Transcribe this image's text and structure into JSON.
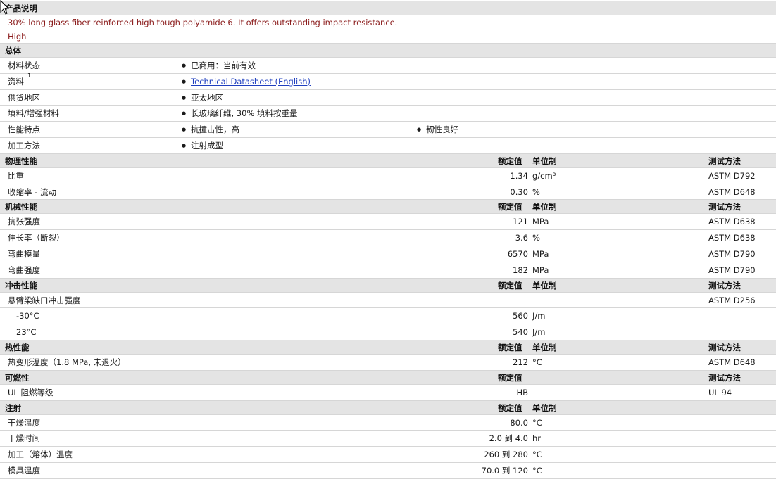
{
  "product": {
    "section_title": "产品说明",
    "description": "30% long glass fiber reinforced high tough polyamide 6. It offers outstanding impact resistance.",
    "extra": "High"
  },
  "general": {
    "section_title": "总体",
    "rows": [
      {
        "label": "材料状态",
        "values": [
          "已商用：当前有效"
        ]
      },
      {
        "label": "资料",
        "sup": "1",
        "values": [
          "Technical Datasheet (English)"
        ],
        "link": true
      },
      {
        "label": "供货地区",
        "values": [
          "亚太地区"
        ]
      },
      {
        "label": "填料/增强材料",
        "values": [
          "长玻璃纤维, 30% 填料按重量"
        ]
      },
      {
        "label": "性能特点",
        "values": [
          "抗撞击性，高",
          "韧性良好"
        ]
      },
      {
        "label": "加工方法",
        "values": [
          "注射成型"
        ]
      }
    ]
  },
  "headers": {
    "nominal": "额定值",
    "unit": "单位制",
    "method": "测试方法"
  },
  "sections": [
    {
      "title": "物理性能",
      "has_unit": true,
      "rows": [
        {
          "label": "比重",
          "value": "1.34",
          "unit": "g/cm³",
          "method": "ASTM D792"
        },
        {
          "label": "收缩率  - 流动",
          "value": "0.30",
          "unit": "%",
          "method": "ASTM D648"
        }
      ]
    },
    {
      "title": "机械性能",
      "has_unit": true,
      "rows": [
        {
          "label": "抗张强度",
          "value": "121",
          "unit": "MPa",
          "method": "ASTM D638"
        },
        {
          "label": "伸长率（断裂）",
          "value": "3.6",
          "unit": "%",
          "method": "ASTM D638"
        },
        {
          "label": "弯曲模量",
          "value": "6570",
          "unit": "MPa",
          "method": "ASTM D790"
        },
        {
          "label": "弯曲强度",
          "value": "182",
          "unit": "MPa",
          "method": "ASTM D790"
        }
      ]
    },
    {
      "title": "冲击性能",
      "has_unit": true,
      "rows": [
        {
          "label": "悬臂梁缺口冲击强度",
          "value": "",
          "unit": "",
          "method": "ASTM D256"
        },
        {
          "label": "-30°C",
          "indent": true,
          "value": "560",
          "unit": "J/m",
          "method": ""
        },
        {
          "label": "23°C",
          "indent": true,
          "value": "540",
          "unit": "J/m",
          "method": ""
        }
      ]
    },
    {
      "title": "热性能",
      "has_unit": true,
      "rows": [
        {
          "label": "热变形温度（1.8 MPa, 未退火）",
          "value": "212",
          "unit": "°C",
          "method": "ASTM D648"
        }
      ]
    },
    {
      "title": "可燃性",
      "has_unit": false,
      "rows": [
        {
          "label": "UL 阻燃等级",
          "value": "HB",
          "unit": "",
          "method": "UL 94"
        }
      ]
    },
    {
      "title": "注射",
      "has_unit": true,
      "has_method": false,
      "rows": [
        {
          "label": "干燥温度",
          "value": "80.0",
          "unit": "°C",
          "method": ""
        },
        {
          "label": "干燥时间",
          "value": "2.0 到  4.0",
          "unit": "hr",
          "method": ""
        },
        {
          "label": "加工（熔体）温度",
          "value": "260 到  280",
          "unit": "°C",
          "method": ""
        },
        {
          "label": "模具温度",
          "value": "70.0 到  120",
          "unit": "°C",
          "method": ""
        }
      ]
    }
  ]
}
